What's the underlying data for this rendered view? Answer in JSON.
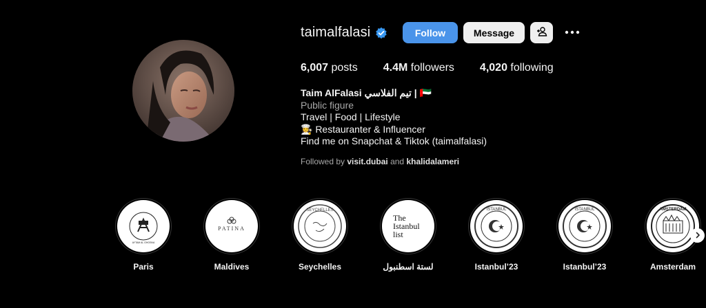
{
  "profile": {
    "username": "taimalfalasi",
    "verified_icon": "verified-badge-icon",
    "follow_label": "Follow",
    "message_label": "Message",
    "add_user_icon": "add-person-icon",
    "more_icon": "more-options-icon"
  },
  "stats": {
    "posts_count": "6,007",
    "posts_label": "posts",
    "followers_count": "4.4M",
    "followers_label": "followers",
    "following_count": "4,020",
    "following_label": "following"
  },
  "bio": {
    "name": "Taim AlFalasi تيم الفلاسي | 🇦🇪",
    "category": "Public figure",
    "line1": "Travel | Food | Lifestyle",
    "line2": "👩‍🍳 Restauranter & Influencer",
    "line3": "Find me on Snapchat & Tiktok (taimalfalasi)"
  },
  "followed_by": {
    "prefix": "Followed by",
    "user1": "visit.dubai",
    "conj": "and",
    "user2": "khalidalameri"
  },
  "highlights": [
    {
      "label": "Paris",
      "cover_text": "AYTAM AL GHOSNA"
    },
    {
      "label": "Maldives",
      "cover_text": "PATINA"
    },
    {
      "label": "Seychelles",
      "cover_text": "SEYCHELLES"
    },
    {
      "label": "لستة اسطنبول",
      "cover_text": "The Istanbul list"
    },
    {
      "label": "Istanbul’23",
      "cover_text": "ISTANBUL"
    },
    {
      "label": "Istanbul’23",
      "cover_text": "ISTANBUL"
    },
    {
      "label": "Amsterdam",
      "cover_text": "AMSTERDAM"
    }
  ],
  "colors": {
    "background": "#000000",
    "follow_button": "#4a94ea",
    "secondary_button": "#efefef",
    "verified": "#3897f0",
    "muted_text": "#a8a8a8"
  },
  "next_icon": "chevron-right-icon"
}
